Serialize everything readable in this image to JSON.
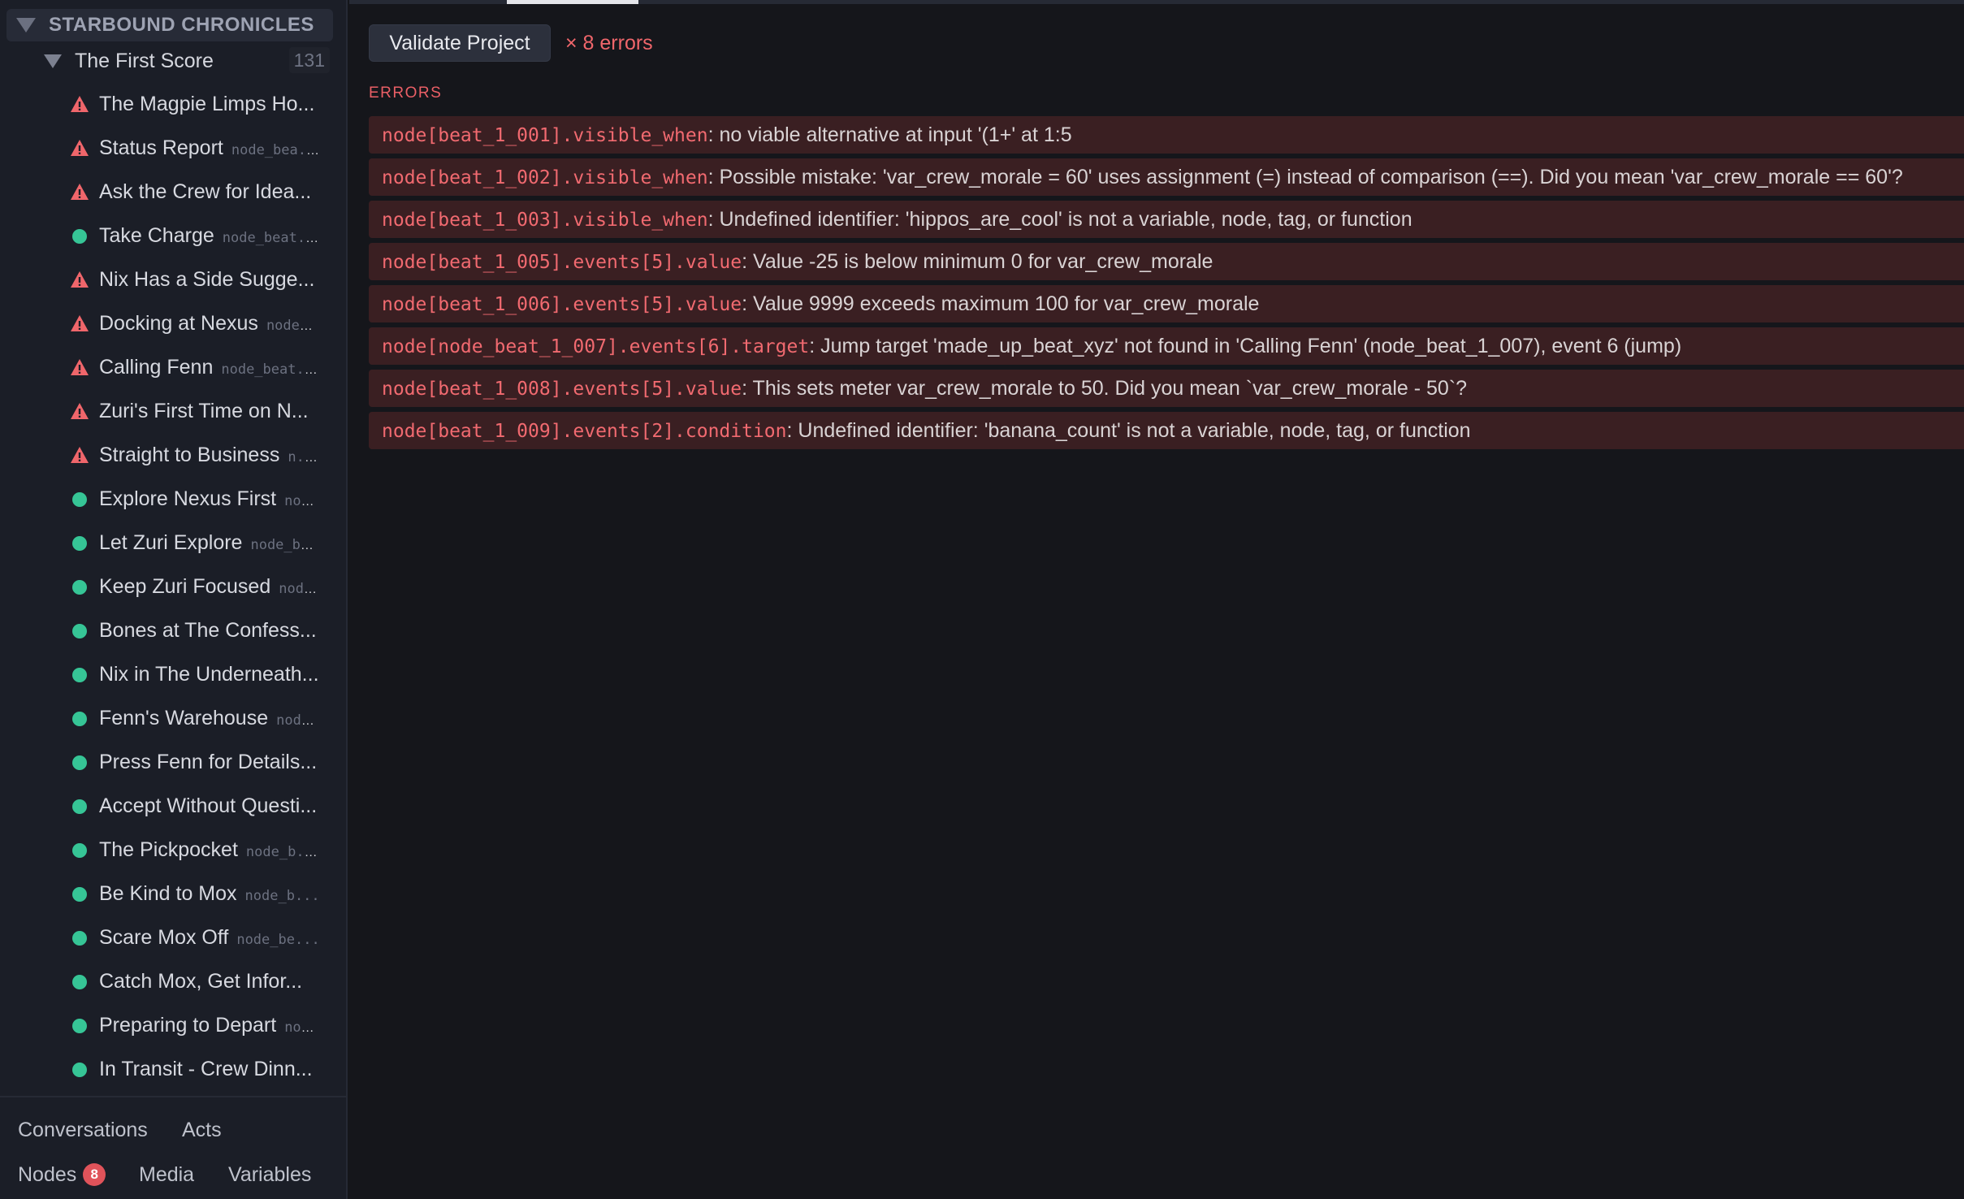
{
  "sidebar": {
    "project_title": "STARBOUND CHRONICLES",
    "group": {
      "label": "The First Score",
      "count": "131"
    },
    "nodes": [
      {
        "title": "The Magpie Limps Ho...",
        "id": "",
        "status": "warning"
      },
      {
        "title": "Status Report",
        "id": "node_bea...",
        "status": "warning"
      },
      {
        "title": "Ask the Crew for Idea...",
        "id": "",
        "status": "warning"
      },
      {
        "title": "Take Charge",
        "id": "node_beat...",
        "status": "ok"
      },
      {
        "title": "Nix Has a Side Sugge...",
        "id": "",
        "status": "warning"
      },
      {
        "title": "Docking at Nexus",
        "id": "node...",
        "status": "warning"
      },
      {
        "title": "Calling Fenn",
        "id": "node_beat...",
        "status": "warning"
      },
      {
        "title": "Zuri's First Time on N...",
        "id": "",
        "status": "warning"
      },
      {
        "title": "Straight to Business",
        "id": "n...",
        "status": "warning"
      },
      {
        "title": "Explore Nexus First",
        "id": "no...",
        "status": "ok"
      },
      {
        "title": "Let Zuri Explore",
        "id": "node_b...",
        "status": "ok"
      },
      {
        "title": "Keep Zuri Focused",
        "id": "nod...",
        "status": "ok"
      },
      {
        "title": "Bones at The Confess...",
        "id": "",
        "status": "ok"
      },
      {
        "title": "Nix in The Underneath...",
        "id": "",
        "status": "ok"
      },
      {
        "title": "Fenn's Warehouse",
        "id": "nod...",
        "status": "ok"
      },
      {
        "title": "Press Fenn for Details...",
        "id": "",
        "status": "ok"
      },
      {
        "title": "Accept Without Questi...",
        "id": "",
        "status": "ok"
      },
      {
        "title": "The Pickpocket",
        "id": "node_b...",
        "status": "ok"
      },
      {
        "title": "Be Kind to Mox",
        "id": "node_b...",
        "status": "ok"
      },
      {
        "title": "Scare Mox Off",
        "id": "node_be...",
        "status": "ok"
      },
      {
        "title": "Catch Mox, Get Infor...",
        "id": "",
        "status": "ok"
      },
      {
        "title": "Preparing to Depart",
        "id": "no...",
        "status": "ok"
      },
      {
        "title": "In Transit - Crew Dinn...",
        "id": "",
        "status": "ok"
      }
    ],
    "bottom_tabs": {
      "conversations": "Conversations",
      "acts": "Acts",
      "nodes": "Nodes",
      "nodes_badge": "8",
      "media": "Media",
      "variables": "Variables"
    }
  },
  "main": {
    "validate_button": "Validate Project",
    "error_count": "× 8 errors",
    "section_label": "ERRORS",
    "errors": [
      {
        "path": "node[beat_1_001].visible_when",
        "message": ": no viable alternative at input '(1+' at 1:5"
      },
      {
        "path": "node[beat_1_002].visible_when",
        "message": ": Possible mistake: 'var_crew_morale = 60' uses assignment (=) instead of comparison (==). Did you mean 'var_crew_morale == 60'?"
      },
      {
        "path": "node[beat_1_003].visible_when",
        "message": ": Undefined identifier: 'hippos_are_cool' is not a variable, node, tag, or function"
      },
      {
        "path": "node[beat_1_005].events[5].value",
        "message": ": Value -25 is below minimum 0 for var_crew_morale"
      },
      {
        "path": "node[beat_1_006].events[5].value",
        "message": ": Value 9999 exceeds maximum 100 for var_crew_morale"
      },
      {
        "path": "node[node_beat_1_007].events[6].target",
        "message": ": Jump target 'made_up_beat_xyz' not found in 'Calling Fenn' (node_beat_1_007), event 6 (jump)"
      },
      {
        "path": "node[beat_1_008].events[5].value",
        "message": ": This sets meter var_crew_morale to 50. Did you mean `var_crew_morale - 50`?"
      },
      {
        "path": "node[beat_1_009].events[2].condition",
        "message": ": Undefined identifier: 'banana_count' is not a variable, node, tag, or function"
      }
    ]
  },
  "colors": {
    "error": "#f16a70",
    "ok": "#36c596",
    "sidebar_bg": "#1b1e27",
    "main_bg": "#15161b"
  }
}
